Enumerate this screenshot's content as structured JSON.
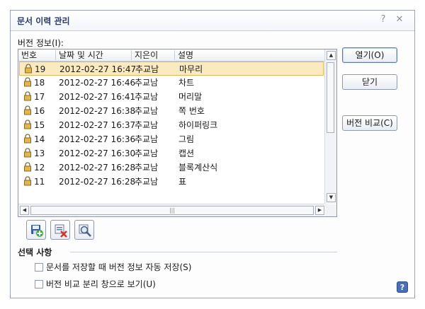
{
  "dialog": {
    "title": "문서 이력 관리",
    "help_glyph": "?",
    "close_glyph": "✕"
  },
  "version_info": {
    "label": "버전 정보(I):",
    "columns": [
      "번호",
      "날짜 및 시간",
      "지은이",
      "설명"
    ],
    "rows": [
      {
        "no": "19",
        "datetime": "2012-02-27 16:47",
        "author": "추교남",
        "desc": "마무리",
        "selected": true
      },
      {
        "no": "18",
        "datetime": "2012-02-27 16:46",
        "author": "추교남",
        "desc": "차트",
        "selected": false
      },
      {
        "no": "17",
        "datetime": "2012-02-27 16:41",
        "author": "추교남",
        "desc": "머리말",
        "selected": false
      },
      {
        "no": "16",
        "datetime": "2012-02-27 16:38",
        "author": "추교남",
        "desc": "쪽 번호",
        "selected": false
      },
      {
        "no": "15",
        "datetime": "2012-02-27 16:37",
        "author": "추교남",
        "desc": "하이퍼링크",
        "selected": false
      },
      {
        "no": "14",
        "datetime": "2012-02-27 16:36",
        "author": "추교남",
        "desc": "그림",
        "selected": false
      },
      {
        "no": "13",
        "datetime": "2012-02-27 16:30",
        "author": "추교남",
        "desc": "캡션",
        "selected": false
      },
      {
        "no": "12",
        "datetime": "2012-02-27 16:28",
        "author": "추교남",
        "desc": "블록계산식",
        "selected": false
      },
      {
        "no": "11",
        "datetime": "2012-02-27 16:28",
        "author": "추교남",
        "desc": "표",
        "selected": false
      }
    ]
  },
  "buttons": {
    "open": "열기(O)",
    "close": "닫기",
    "compare": "버전 비교(C)"
  },
  "toolbar_icons": [
    "save-version-icon",
    "delete-version-icon",
    "view-version-icon"
  ],
  "options": {
    "section_title": "선택 사항",
    "auto_save": "문서를 저장할 때 버전 정보 자동 저장(S)",
    "split_view": "버전 비교 분리 창으로 보기(U)"
  },
  "colors": {
    "selected_row": "#fbe9c0",
    "title_text": "#2d3a6b",
    "help_button": "#4a6fb5"
  }
}
